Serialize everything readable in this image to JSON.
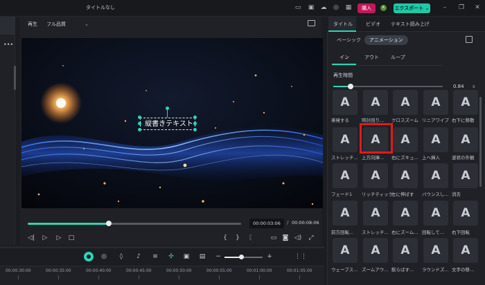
{
  "window": {
    "title": "タイトルなし"
  },
  "header": {
    "buy_label": "購入",
    "avatar_letter": "K",
    "export_label": "エクスポート ⌄"
  },
  "player": {
    "play_label": "再生",
    "quality": "フル品質",
    "overlay_text": "縦書きテキスト",
    "progress": 0.38,
    "time_current": "00:00:03:06",
    "time_sep": "/",
    "time_total": "00:00:08:06",
    "bracket_in": "{",
    "bracket_out": "}"
  },
  "timeline": {
    "zoom_minus": "−",
    "zoom_plus": "+",
    "ticks": [
      "00:00:30:00",
      "00:00:35:00",
      "00:00:40:00",
      "00:00:45:00",
      "00:00:50:00",
      "00:00:55:00",
      "00:01:00:00",
      "00:01:05:00"
    ]
  },
  "right_panel": {
    "tabs": [
      "タイトル",
      "ビデオ",
      "テキスト読み上げ"
    ],
    "subtabs": [
      "ベーシック",
      "アニメーション"
    ],
    "phase_tabs": [
      "イン",
      "アウト",
      "ループ"
    ],
    "duration_label": "再生時間",
    "duration_value": "0.84",
    "duration_unit": "s",
    "duration_fraction": 0.16,
    "presets": [
      "楽発する",
      "時計回り...",
      "クロスズーム",
      "リニアワイプ",
      "右下に移動",
      "ストレッチ...",
      "上方向揮...",
      "右にズキュ...",
      "上へ挿入",
      "波状の外観",
      "フェード1",
      "リッチティック",
      "左に伸ばす",
      "バウンスし...",
      "消去",
      "前方回転...",
      "ストレッチ...",
      "右にズーム...",
      "回転して...",
      "右下回転",
      "ウェーブス...",
      "ズームアウ...",
      "飲らばす...",
      "ラウンドズ...",
      "文字の移..."
    ]
  }
}
